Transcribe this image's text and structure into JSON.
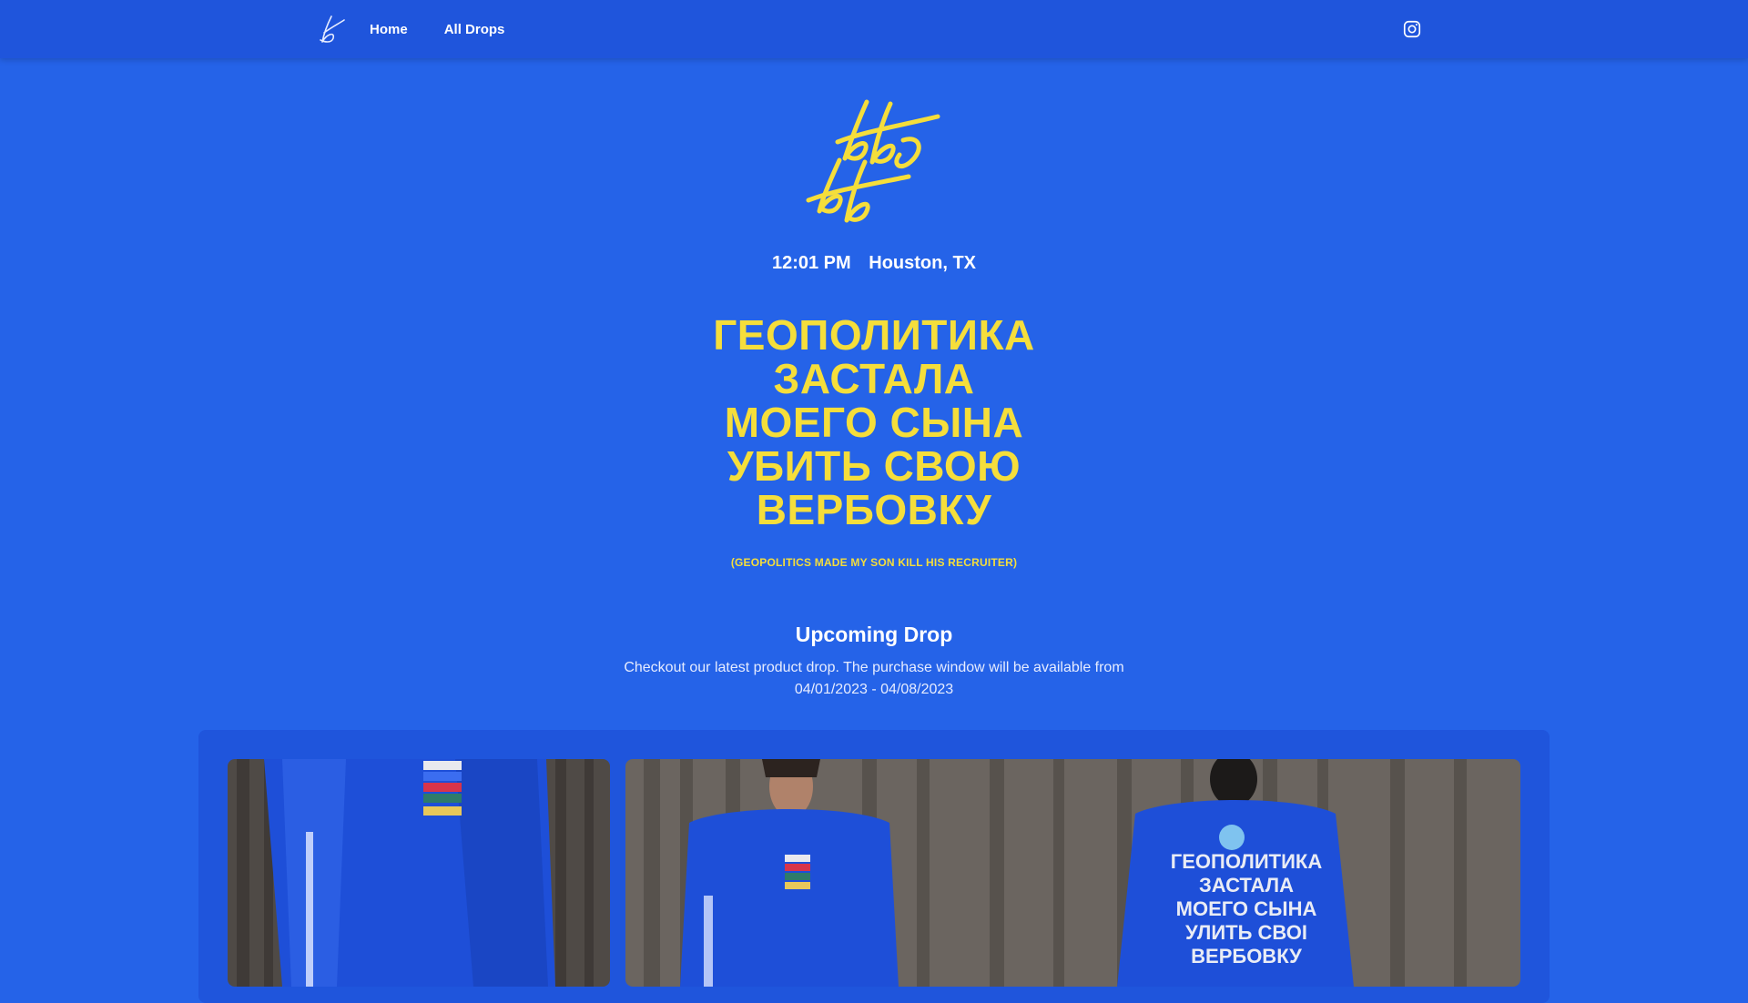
{
  "nav": {
    "logo_icon": "signature-b-logo",
    "links": [
      {
        "label": "Home"
      },
      {
        "label": "All Drops"
      }
    ],
    "social_icon": "instagram-icon"
  },
  "hero": {
    "logo_icon": "signature-bb-logo",
    "time": "12:01 PM",
    "location": "Houston, TX",
    "headline_lines": [
      "ГЕОПОЛИТИКА",
      "ЗАСТАЛА",
      "МОЕГО СЫНА",
      "УБИТЬ СВОЮ",
      "ВЕРБОВКУ"
    ],
    "translation": "(GEOPOLITICS MADE MY SON KILL HIS RECRUITER)"
  },
  "drop": {
    "title": "Upcoming Drop",
    "description": "Checkout our latest product drop. The purchase window will be available from 04/01/2023 - 04/08/2023"
  },
  "gallery": {
    "photos": [
      {
        "name": "sleeve-closeup-photo"
      },
      {
        "name": "front-and-back-photo",
        "shirt_print_lines": [
          "ГЕОПОЛИТИКА",
          "ЗАСТАЛА",
          "МОЕГО СЫНА",
          "УЛИТЬ СВОI",
          "ВЕРБОВКУ"
        ]
      }
    ]
  },
  "colors": {
    "background": "#2563e8",
    "nav": "#1f55dc",
    "accent_yellow": "#f5de3b",
    "text": "#ffffff"
  }
}
